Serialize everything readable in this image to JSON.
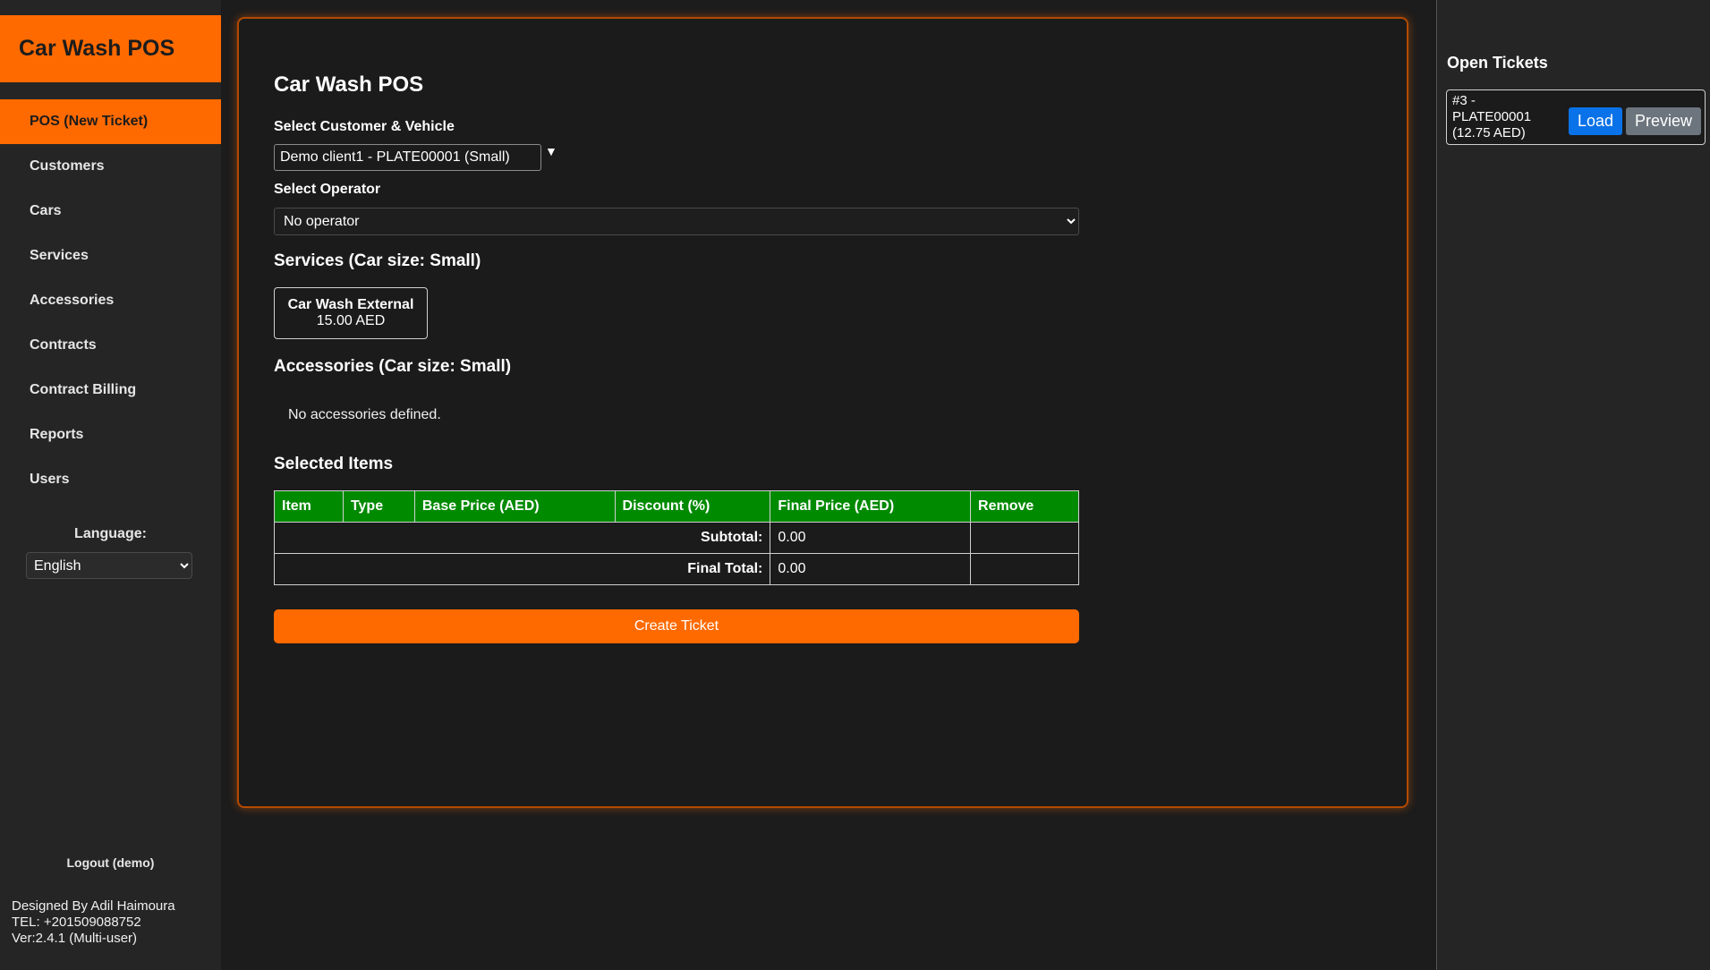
{
  "sidebar": {
    "brand": "Car Wash POS",
    "items": [
      {
        "label": "POS (New Ticket)",
        "active": true
      },
      {
        "label": "Customers"
      },
      {
        "label": "Cars"
      },
      {
        "label": "Services"
      },
      {
        "label": "Accessories"
      },
      {
        "label": "Contracts"
      },
      {
        "label": "Contract Billing"
      },
      {
        "label": "Reports"
      },
      {
        "label": "Users"
      }
    ],
    "language_label": "Language:",
    "language_value": "English",
    "logout_label": "Logout (demo)",
    "credits": {
      "line1": "Designed By Adil Haimoura",
      "line2": "TEL: +201509088752",
      "line3": "Ver:2.4.1 (Multi-user)"
    }
  },
  "main": {
    "title": "Car Wash POS",
    "customer_label": "Select Customer & Vehicle",
    "customer_value": "Demo client1 - PLATE00001 (Small)",
    "operator_label": "Select Operator",
    "operator_value": "No operator",
    "services_title": "Services (Car size: Small)",
    "services": [
      {
        "name": "Car Wash External",
        "price": "15.00 AED"
      }
    ],
    "accessories_title": "Accessories (Car size: Small)",
    "accessories_empty": "No accessories defined.",
    "selected_title": "Selected Items",
    "table": {
      "columns": [
        "Item",
        "Type",
        "Base Price (AED)",
        "Discount (%)",
        "Final Price (AED)",
        "Remove"
      ],
      "subtotal_label": "Subtotal:",
      "subtotal_value": "0.00",
      "final_label": "Final Total:",
      "final_value": "0.00"
    },
    "create_button": "Create Ticket"
  },
  "right_panel": {
    "title": "Open Tickets",
    "tickets": [
      {
        "line1": "#3 -",
        "line2": "PLATE00001",
        "line3": "(12.75 AED)",
        "load": "Load",
        "preview": "Preview"
      }
    ]
  },
  "colors": {
    "accent": "#ff6a00",
    "table_header": "#008a00",
    "load_button": "#0a72e8",
    "preview_button": "#6c757d",
    "background": "#1c1c1c"
  }
}
